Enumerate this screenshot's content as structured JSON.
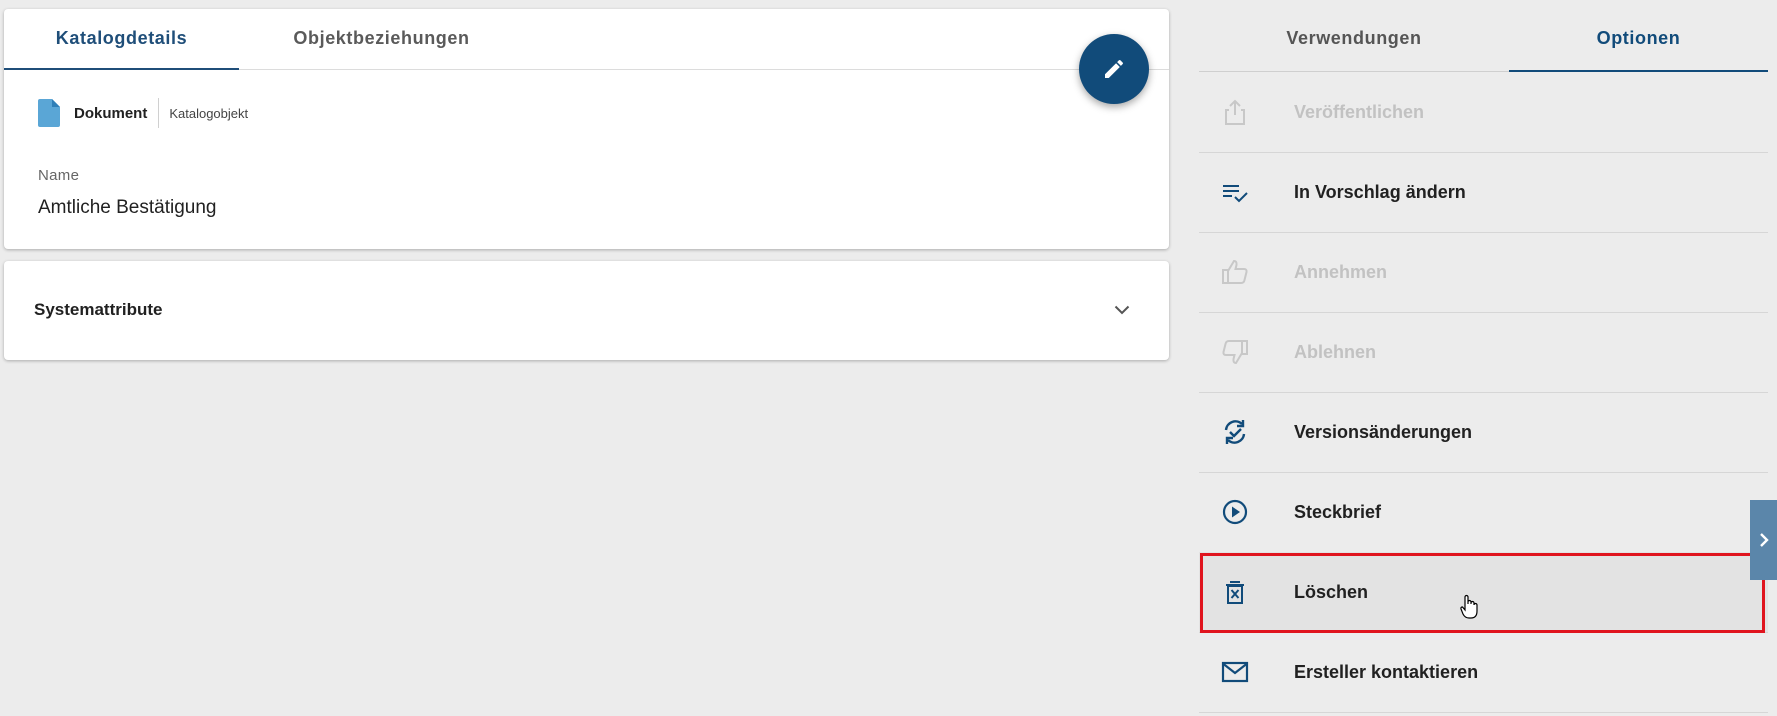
{
  "main": {
    "tabs": [
      {
        "label": "Katalogdetails",
        "active": true
      },
      {
        "label": "Objektbeziehungen",
        "active": false
      }
    ],
    "edit_icon": "pencil-icon",
    "object_type": {
      "icon": "document-icon",
      "label": "Dokument",
      "kind": "Katalogobjekt"
    },
    "field": {
      "label": "Name",
      "value": "Amtliche Bestätigung"
    }
  },
  "system_attributes": {
    "title": "Systemattribute",
    "icon": "chevron-down-icon"
  },
  "side_panel": {
    "tabs": [
      {
        "label": "Verwendungen",
        "active": false
      },
      {
        "label": "Optionen",
        "active": true
      }
    ],
    "options": [
      {
        "label": "Veröffentlichen",
        "icon": "share-upload-icon",
        "disabled": true
      },
      {
        "label": "In Vorschlag ändern",
        "icon": "list-check-icon",
        "disabled": false
      },
      {
        "label": "Annehmen",
        "icon": "thumb-up-icon",
        "disabled": true
      },
      {
        "label": "Ablehnen",
        "icon": "thumb-down-icon",
        "disabled": true
      },
      {
        "label": "Versionsänderungen",
        "icon": "sync-check-icon",
        "disabled": false
      },
      {
        "label": "Steckbrief",
        "icon": "play-circle-icon",
        "disabled": false
      },
      {
        "label": "Löschen",
        "icon": "trash-icon",
        "disabled": false,
        "hovered": true,
        "highlighted": true
      },
      {
        "label": "Ersteller kontaktieren",
        "icon": "mail-icon",
        "disabled": false
      }
    ]
  },
  "colors": {
    "primary": "#114b7a",
    "disabled_text": "#c2c2c2",
    "highlight_border": "#e0141e",
    "background": "#ececec"
  }
}
